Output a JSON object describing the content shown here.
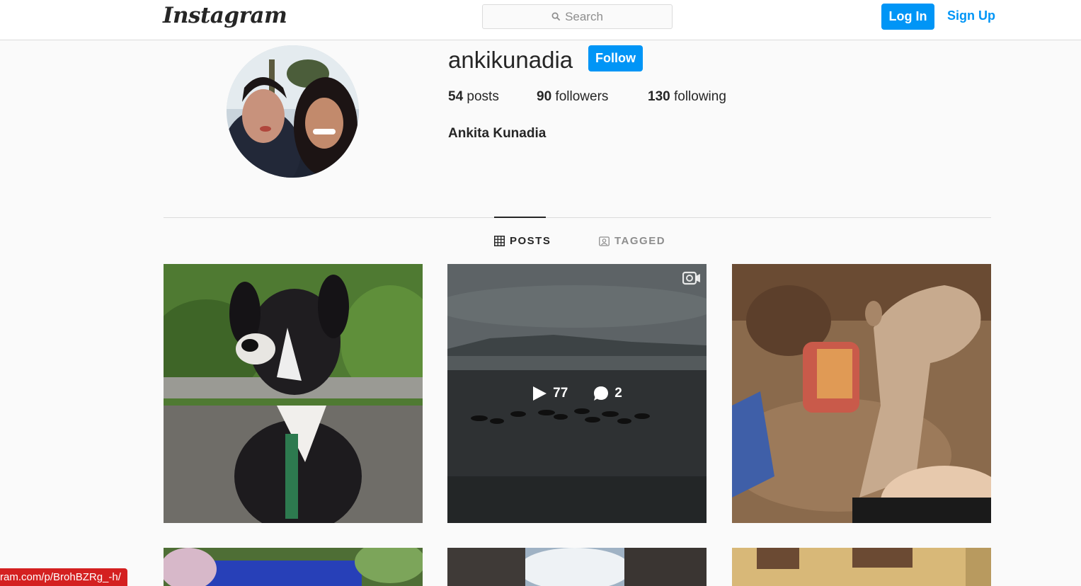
{
  "nav": {
    "logo": "Instagram",
    "search_placeholder": "Search",
    "login_label": "Log In",
    "signup_label": "Sign Up"
  },
  "profile": {
    "username": "ankikunadia",
    "follow_label": "Follow",
    "posts_count": "54",
    "posts_label": "posts",
    "followers_count": "90",
    "followers_label": "followers",
    "following_count": "130",
    "following_label": "following",
    "full_name": "Ankita Kunadia"
  },
  "tabs": {
    "posts": "POSTS",
    "tagged": "TAGGED"
  },
  "hovered_post": {
    "views": "77",
    "comments": "2"
  },
  "status_url": "ram.com/p/BrohBZRg_-h/",
  "colors": {
    "accent": "#0095f6",
    "status": "#d42020"
  }
}
